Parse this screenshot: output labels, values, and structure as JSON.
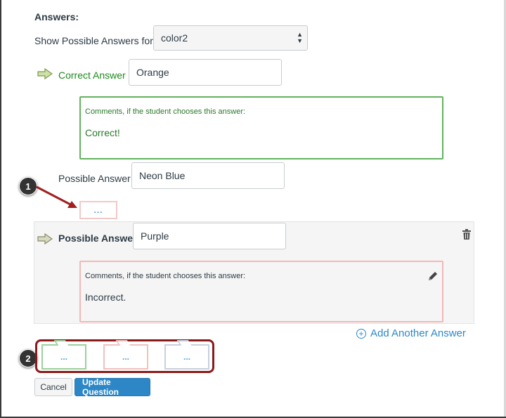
{
  "section": {
    "header": "Answers:",
    "show_for_label": "Show Possible Answers for",
    "show_for_value": "color2"
  },
  "correct_answer": {
    "label": "Correct Answer",
    "value": "Orange",
    "comment_title": "Comments, if the student chooses this answer:",
    "comment_text": "Correct!"
  },
  "possible_answer_1": {
    "label": "Possible Answer",
    "value": "Neon Blue",
    "dots": "..."
  },
  "possible_answer_2": {
    "label": "Possible Answer",
    "value": "Purple",
    "comment_title": "Comments, if the student chooses this answer:",
    "comment_text": "Incorrect."
  },
  "add_answer_label": "Add Another Answer",
  "comment_buttons": [
    "...",
    "...",
    "..."
  ],
  "callouts": [
    "1",
    "2"
  ],
  "buttons": {
    "cancel": "Cancel",
    "update": "Update Question"
  },
  "colors": {
    "correct_green": "#62b25e",
    "incorrect_red": "#f2b8b8",
    "neutral_blue": "#b8c4d9",
    "accent_blue": "#2d87c7",
    "callout_outline": "#8b1a1a"
  },
  "icons": [
    "arrow-right-icon",
    "trash-icon",
    "pencil-icon",
    "plus-circle-icon",
    "select-arrows-icon"
  ]
}
